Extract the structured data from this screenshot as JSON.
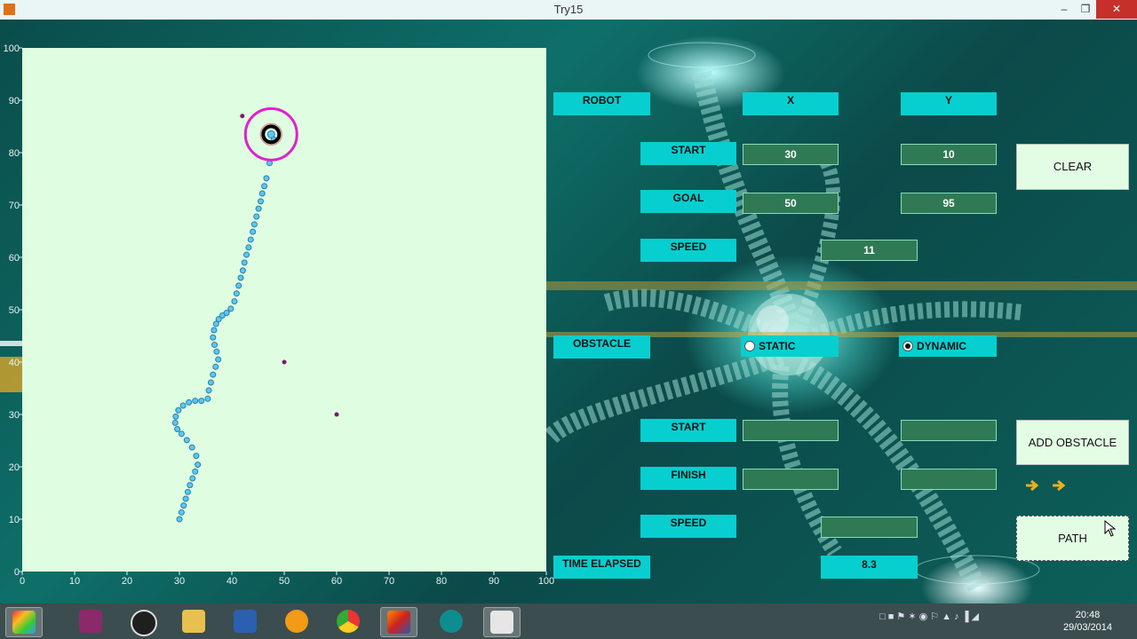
{
  "window": {
    "title": "Try15"
  },
  "plot": {
    "x_ticks": [
      "0",
      "10",
      "20",
      "30",
      "40",
      "50",
      "60",
      "70",
      "80",
      "90",
      "100"
    ],
    "y_ticks": [
      "0",
      "10",
      "20",
      "30",
      "40",
      "50",
      "60",
      "70",
      "80",
      "90",
      "100"
    ],
    "xlim": [
      0,
      100
    ],
    "ylim": [
      0,
      100
    ],
    "path_color": "#5bc8ee",
    "goal_ring_color": "#e020d0",
    "obstacle_color": "#7a1a6e"
  },
  "chart_data": {
    "type": "scatter",
    "xlim": [
      0,
      100
    ],
    "ylim": [
      0,
      100
    ],
    "series": [
      {
        "kind": "robot-path",
        "x": [
          30,
          30.4,
          30.8,
          31.2,
          31.6,
          32,
          32.5,
          33,
          33.5,
          33.2,
          32.4,
          31.4,
          30.4,
          29.6,
          29.2,
          29.3,
          29.8,
          30.7,
          31.8,
          33,
          34.2,
          35.4,
          35.6,
          36,
          36.4,
          36.9,
          37.4,
          37.1,
          36.7,
          36.4,
          36.6,
          37,
          37.5,
          38.2,
          39,
          39.8,
          40.5,
          40.9,
          41.3,
          41.7,
          42.1,
          42.4,
          42.8,
          43.2,
          43.6,
          44,
          44.3,
          44.7,
          45.1,
          45.5,
          45.8,
          46.2,
          46.6,
          47.2,
          48
        ],
        "y": [
          10,
          11.3,
          12.6,
          13.9,
          15.2,
          16.5,
          17.8,
          19.1,
          20.4,
          22.1,
          23.7,
          25.1,
          26.3,
          27.2,
          28.4,
          29.6,
          30.8,
          31.7,
          32.3,
          32.6,
          32.6,
          33,
          34.6,
          36.1,
          37.6,
          39.1,
          40.5,
          42,
          43.3,
          44.7,
          46.1,
          47.3,
          48.2,
          48.9,
          49.4,
          50.2,
          51.6,
          53.1,
          54.6,
          56.1,
          57.5,
          59,
          60.5,
          61.9,
          63.4,
          64.9,
          66.3,
          67.8,
          69.3,
          70.7,
          72.2,
          73.6,
          75.1,
          78,
          82.5
        ]
      },
      {
        "kind": "obstacle",
        "x": [
          42,
          50,
          60
        ],
        "y": [
          87,
          40,
          30
        ]
      }
    ],
    "goal_marker": {
      "x": 47.5,
      "y": 83.5
    }
  },
  "panel": {
    "headers": {
      "robot": "ROBOT",
      "x": "X",
      "y": "Y"
    },
    "start": {
      "label": "START",
      "x": "30",
      "y": "10"
    },
    "goal": {
      "label": "GOAL",
      "x": "50",
      "y": "95"
    },
    "speed": {
      "label": "SPEED",
      "value": "11"
    },
    "obstacle": {
      "label": "OBSTACLE",
      "static_label": "STATIC",
      "dynamic_label": "DYNAMIC",
      "selected": "dynamic",
      "start_label": "START",
      "start_x": "",
      "start_y": "",
      "finish_label": "FINISH",
      "finish_x": "",
      "finish_y": "",
      "speed_label": "SPEED",
      "speed_value": ""
    },
    "time_elapsed": {
      "label": "TIME ELAPSED",
      "value": "8.3"
    },
    "buttons": {
      "clear": "CLEAR",
      "add_obstacle": "ADD OBSTACLE",
      "path": "PATH"
    }
  },
  "taskbar": {
    "icons": [
      "start-icon",
      "remote-icon",
      "hp-icon",
      "file-explorer-icon",
      "word-icon",
      "media-player-icon",
      "chrome-icon",
      "matlab-icon",
      "arduino-icon",
      "app-window-icon"
    ],
    "time": "20:48",
    "date": "29/03/2014"
  }
}
